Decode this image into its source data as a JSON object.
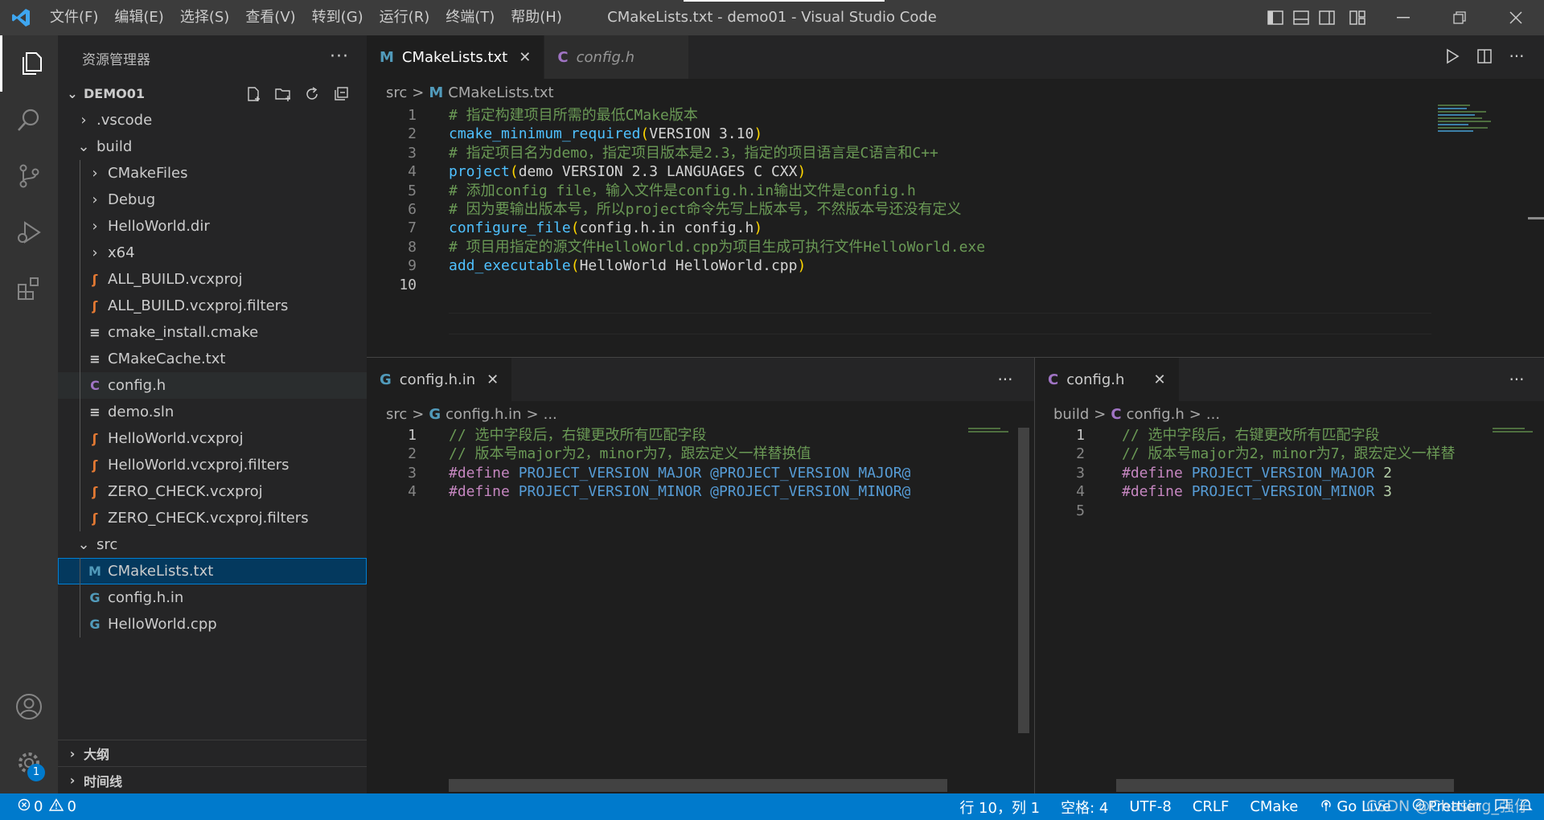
{
  "window": {
    "title": "CMakeLists.txt - demo01 - Visual Studio Code",
    "menu": [
      "文件(F)",
      "编辑(E)",
      "选择(S)",
      "查看(V)",
      "转到(G)",
      "运行(R)",
      "终端(T)",
      "帮助(H)"
    ]
  },
  "activity": {
    "settings_badge": "1"
  },
  "sidebar": {
    "title": "资源管理器",
    "more": "···",
    "root": "DEMO01",
    "tree": [
      {
        "label": ".vscode",
        "type": "folder",
        "open": false,
        "indent": 1
      },
      {
        "label": "build",
        "type": "folder",
        "open": true,
        "indent": 1
      },
      {
        "label": "CMakeFiles",
        "type": "folder",
        "open": false,
        "indent": 2
      },
      {
        "label": "Debug",
        "type": "folder",
        "open": false,
        "indent": 2
      },
      {
        "label": "HelloWorld.dir",
        "type": "folder",
        "open": false,
        "indent": 2
      },
      {
        "label": "x64",
        "type": "folder",
        "open": false,
        "indent": 2
      },
      {
        "label": "ALL_BUILD.vcxproj",
        "type": "rss",
        "indent": 2
      },
      {
        "label": "ALL_BUILD.vcxproj.filters",
        "type": "rss",
        "indent": 2
      },
      {
        "label": "cmake_install.cmake",
        "type": "lines",
        "indent": 2
      },
      {
        "label": "CMakeCache.txt",
        "type": "lines",
        "indent": 2
      },
      {
        "label": "config.h",
        "type": "c",
        "indent": 2,
        "hover": true
      },
      {
        "label": "demo.sln",
        "type": "lines",
        "indent": 2
      },
      {
        "label": "HelloWorld.vcxproj",
        "type": "rss",
        "indent": 2
      },
      {
        "label": "HelloWorld.vcxproj.filters",
        "type": "rss",
        "indent": 2
      },
      {
        "label": "ZERO_CHECK.vcxproj",
        "type": "rss",
        "indent": 2
      },
      {
        "label": "ZERO_CHECK.vcxproj.filters",
        "type": "rss",
        "indent": 2
      },
      {
        "label": "src",
        "type": "folder",
        "open": true,
        "indent": 1
      },
      {
        "label": "CMakeLists.txt",
        "type": "m",
        "indent": 2,
        "selected": true
      },
      {
        "label": "config.h.in",
        "type": "cpp",
        "indent": 2
      },
      {
        "label": "HelloWorld.cpp",
        "type": "cpp",
        "indent": 2
      }
    ],
    "outline": "大纲",
    "timeline": "时间线"
  },
  "editor_top": {
    "tabs": [
      {
        "label": "CMakeLists.txt",
        "icon": "M",
        "close": "✕",
        "active": true
      },
      {
        "label": "config.h",
        "icon": "C",
        "active": false
      }
    ],
    "breadcrumb": [
      "src",
      ">",
      "M",
      "CMakeLists.txt"
    ],
    "lines": [
      {
        "n": "1",
        "parts": [
          [
            "c-comment",
            "# 指定构建项目所需的最低CMake版本"
          ]
        ]
      },
      {
        "n": "2",
        "parts": [
          [
            "c-fn",
            "cmake_minimum_required"
          ],
          [
            "c-paren",
            "("
          ],
          [
            "c-text",
            "VERSION 3.10"
          ],
          [
            "c-paren",
            ")"
          ]
        ]
      },
      {
        "n": "3",
        "parts": [
          [
            "c-comment",
            "# 指定项目名为demo，指定项目版本是2.3，指定的项目语言是C语言和C++"
          ]
        ]
      },
      {
        "n": "4",
        "parts": [
          [
            "c-fn",
            "project"
          ],
          [
            "c-paren",
            "("
          ],
          [
            "c-text",
            "demo VERSION 2.3 LANGUAGES C CXX"
          ],
          [
            "c-paren",
            ")"
          ]
        ]
      },
      {
        "n": "5",
        "parts": [
          [
            "c-comment",
            "# 添加config file，输入文件是config.h.in输出文件是config.h"
          ]
        ]
      },
      {
        "n": "6",
        "parts": [
          [
            "c-comment",
            "# 因为要输出版本号，所以project命令先写上版本号，不然版本号还没有定义"
          ]
        ]
      },
      {
        "n": "7",
        "parts": [
          [
            "c-fn",
            "configure_file"
          ],
          [
            "c-paren",
            "("
          ],
          [
            "c-text",
            "config.h.in config.h"
          ],
          [
            "c-paren",
            ")"
          ]
        ]
      },
      {
        "n": "8",
        "parts": [
          [
            "c-comment",
            "# 项目用指定的源文件HelloWorld.cpp为项目生成可执行文件HelloWorld.exe"
          ]
        ]
      },
      {
        "n": "9",
        "parts": [
          [
            "c-fn",
            "add_executable"
          ],
          [
            "c-paren",
            "("
          ],
          [
            "c-text",
            "HelloWorld HelloWorld.cpp"
          ],
          [
            "c-paren",
            ")"
          ]
        ]
      },
      {
        "n": "10",
        "parts": []
      }
    ]
  },
  "editor_left": {
    "tab": {
      "label": "config.h.in",
      "icon": "G",
      "close": "✕"
    },
    "breadcrumb": [
      "src",
      ">",
      "G",
      "config.h.in",
      ">",
      "..."
    ],
    "lines": [
      {
        "n": "1",
        "parts": [
          [
            "c-comment",
            "// 选中字段后，右键更改所有匹配字段"
          ]
        ]
      },
      {
        "n": "2",
        "parts": [
          [
            "c-comment",
            "// 版本号major为2，minor为7，跟宏定义一样替换值"
          ]
        ]
      },
      {
        "n": "3",
        "parts": [
          [
            "c-kw",
            "#define"
          ],
          [
            "c-text",
            " "
          ],
          [
            "c-macro",
            "PROJECT_VERSION_MAJOR"
          ],
          [
            "c-text",
            " "
          ],
          [
            "c-macro",
            "@PROJECT_VERSION_MAJOR@"
          ]
        ]
      },
      {
        "n": "4",
        "parts": [
          [
            "c-kw",
            "#define"
          ],
          [
            "c-text",
            " "
          ],
          [
            "c-macro",
            "PROJECT_VERSION_MINOR"
          ],
          [
            "c-text",
            " "
          ],
          [
            "c-macro",
            "@PROJECT_VERSION_MINOR@"
          ]
        ]
      }
    ]
  },
  "editor_right": {
    "tab": {
      "label": "config.h",
      "icon": "C",
      "close": "✕"
    },
    "breadcrumb": [
      "build",
      ">",
      "C",
      "config.h",
      ">",
      "..."
    ],
    "lines": [
      {
        "n": "1",
        "parts": [
          [
            "c-comment",
            "// 选中字段后，右键更改所有匹配字段"
          ]
        ]
      },
      {
        "n": "2",
        "parts": [
          [
            "c-comment",
            "// 版本号major为2，minor为7，跟宏定义一样替"
          ]
        ]
      },
      {
        "n": "3",
        "parts": [
          [
            "c-kw",
            "#define"
          ],
          [
            "c-text",
            " "
          ],
          [
            "c-macro",
            "PROJECT_VERSION_MAJOR"
          ],
          [
            "c-text",
            " "
          ],
          [
            "c-num",
            "2"
          ]
        ]
      },
      {
        "n": "4",
        "parts": [
          [
            "c-kw",
            "#define"
          ],
          [
            "c-text",
            " "
          ],
          [
            "c-macro",
            "PROJECT_VERSION_MINOR"
          ],
          [
            "c-text",
            " "
          ],
          [
            "c-num",
            "3"
          ]
        ]
      },
      {
        "n": "5",
        "parts": []
      }
    ]
  },
  "statusbar": {
    "errors": "0",
    "warnings": "0",
    "position": "行 10，列 1",
    "spaces": "空格: 4",
    "encoding": "UTF-8",
    "eol": "CRLF",
    "language": "CMake",
    "golive": "Go Live",
    "prettier": "Prettier",
    "watermark": "CSDN @Chasing_强仔"
  },
  "colors": {
    "accent": "#007acc",
    "rss": "#e37933",
    "c_icon": "#a074c4",
    "cpp_icon": "#519aba",
    "m_icon": "#519aba"
  }
}
